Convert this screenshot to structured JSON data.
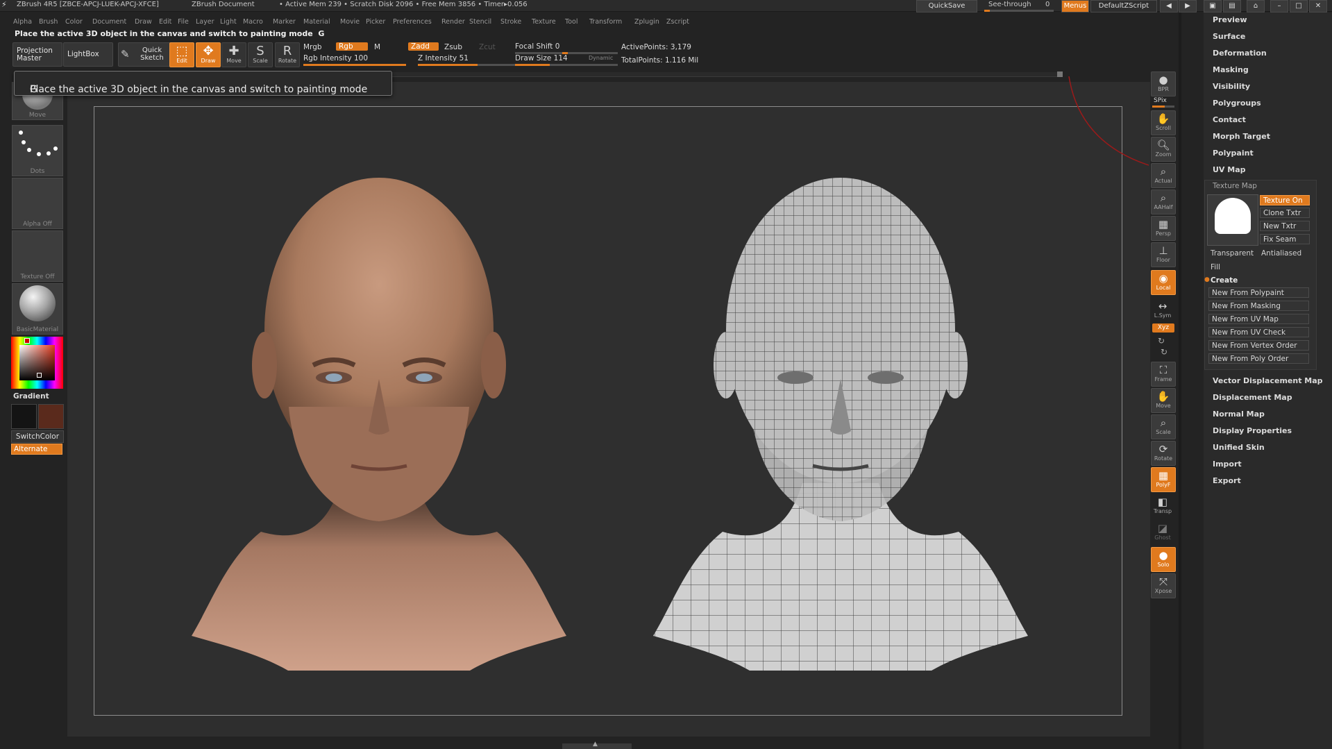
{
  "title": {
    "app": "ZBrush 4R5 [ZBCE-APCJ-LUEK-APCJ-XFCE]",
    "doc": "ZBrush Document",
    "stats": "• Active Mem 239 • Scratch Disk 2096 • Free Mem 3856 • Timer▸0.056",
    "quicksave": "QuickSave",
    "seethrough": "See-through",
    "seethrough_value": "0",
    "menus": "Menus",
    "script": "DefaultZScript"
  },
  "menu": [
    "Alpha",
    "Brush",
    "Color",
    "Document",
    "Draw",
    "Edit",
    "File",
    "Layer",
    "Light",
    "Macro",
    "Marker",
    "Material",
    "Movie",
    "Picker",
    "Preferences",
    "Render",
    "Stencil",
    "Stroke",
    "Texture",
    "Tool",
    "Transform",
    "Zplugin",
    "Zscript"
  ],
  "message": "Place the active 3D object in the canvas and switch to painting mode",
  "message_hotkey": "G",
  "toolbar": {
    "projection_master": "Projection Master",
    "lightbox": "LightBox",
    "quick_sketch": "Quick Sketch",
    "edit": "Edit",
    "draw": "Draw",
    "move": "Move",
    "scale": "Scale",
    "rotate": "Rotate",
    "mrgb": "Mrgb",
    "rgb": "Rgb",
    "m": "M",
    "zadd": "Zadd",
    "zsub": "Zsub",
    "zcut": "Zcut",
    "rgb_intensity": "Rgb Intensity 100",
    "z_intensity": "Z Intensity 51",
    "focal_shift": "Focal Shift 0",
    "draw_size": "Draw Size 114",
    "dynamic": "Dynamic",
    "active_points": "ActivePoints: 3,179",
    "total_points": "TotalPoints: 1.116 Mil"
  },
  "tooltip": {
    "text": "Place the active 3D object in the canvas and switch to painting mode",
    "hotkey": "G"
  },
  "left_shelf": {
    "brush": "Move",
    "stroke": "Dots",
    "alpha": "Alpha Off",
    "texture": "Texture Off",
    "material": "BasicMaterial",
    "gradient": "Gradient",
    "switchcolor": "SwitchColor",
    "alternate": "Alternate",
    "main_color": "#141414",
    "secondary_color": "#5a2a1c"
  },
  "right_shelf": [
    {
      "label": "BPR",
      "icon": "sphere-icon"
    },
    {
      "label": "SPix",
      "icon": "spix-slider"
    },
    {
      "label": "Scroll",
      "icon": "hand-icon"
    },
    {
      "label": "Zoom",
      "icon": "magnifier-icon"
    },
    {
      "label": "Actual",
      "icon": "magnifier-icon"
    },
    {
      "label": "AAHalf",
      "icon": "magnifier-icon"
    },
    {
      "label": "Persp",
      "icon": "grid-icon"
    },
    {
      "label": "Floor",
      "icon": "floor-icon"
    },
    {
      "label": "Local",
      "icon": "local-icon"
    },
    {
      "label": "L.Sym",
      "icon": "symmetry-icon"
    },
    {
      "label": "Xyz",
      "icon": "xyz-icon"
    },
    {
      "label": "Frame",
      "icon": "frame-icon"
    },
    {
      "label": "Move",
      "icon": "hand-icon"
    },
    {
      "label": "Scale",
      "icon": "magnifier-icon"
    },
    {
      "label": "Rotate",
      "icon": "rotate-icon"
    },
    {
      "label": "PolyF",
      "icon": "polyframe-icon"
    },
    {
      "label": "Transp",
      "icon": "transp-icon"
    },
    {
      "label": "Ghost",
      "icon": "ghost-icon"
    },
    {
      "label": "Solo",
      "icon": "solo-icon"
    },
    {
      "label": "Xpose",
      "icon": "xpose-icon"
    }
  ],
  "palette": {
    "top_items": [
      "Preview",
      "Surface",
      "Deformation",
      "Masking",
      "Visibility",
      "Polygroups",
      "Contact",
      "Morph Target",
      "Polypaint",
      "UV Map"
    ],
    "texture_map": {
      "header": "Texture Map",
      "texture_on": "Texture On",
      "clone_txtr": "Clone Txtr",
      "new_txtr": "New Txtr",
      "fix_seam": "Fix Seam",
      "transparent": "Transparent",
      "antialiased": "Antialiased",
      "fill": "Fill",
      "create": "Create",
      "create_items": [
        "New From Polypaint",
        "New From Masking",
        "New From UV Map",
        "New From UV Check",
        "New From Vertex Order",
        "New From Poly Order"
      ]
    },
    "bottom_items": [
      "Vector Displacement Map",
      "Displacement Map",
      "Normal Map",
      "Display Properties",
      "Unified Skin",
      "Import",
      "Export"
    ]
  }
}
